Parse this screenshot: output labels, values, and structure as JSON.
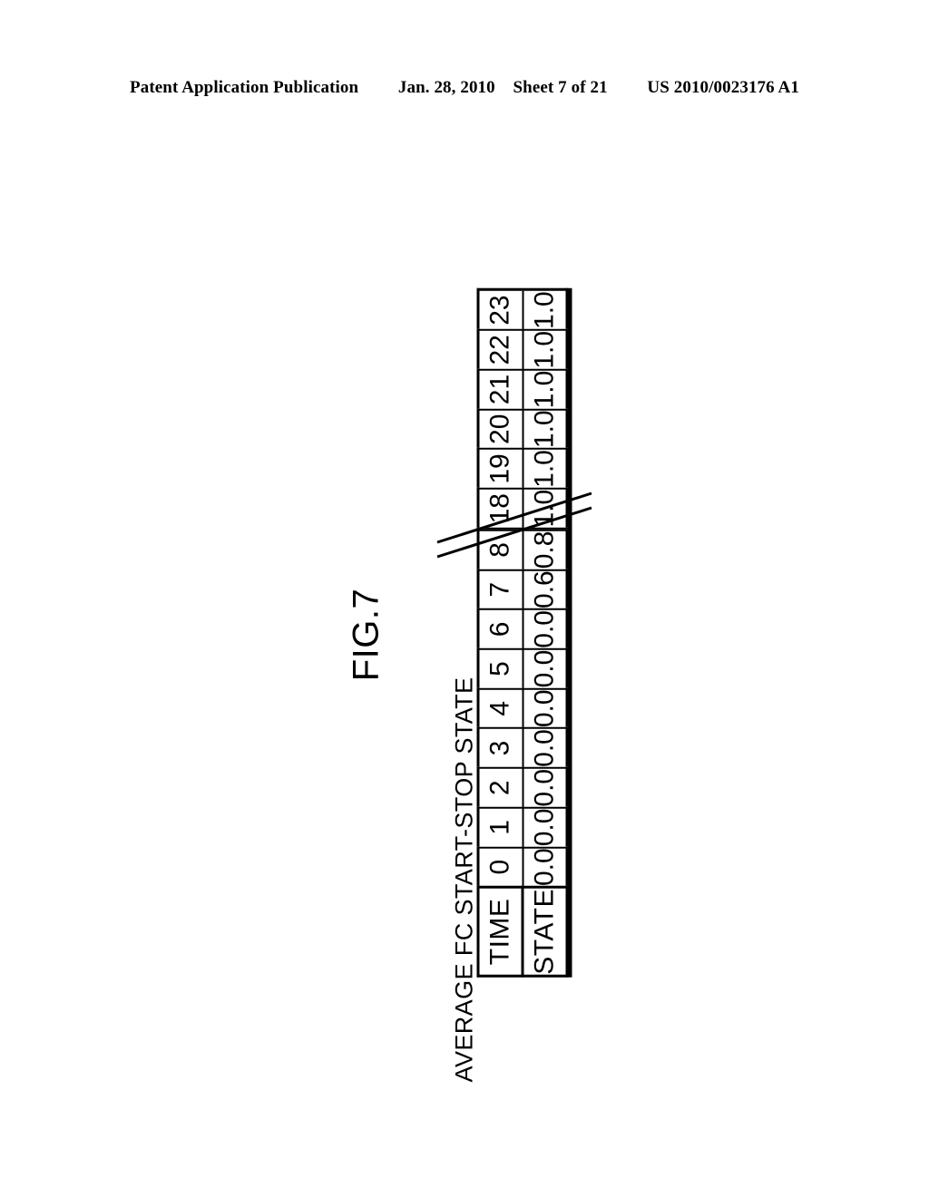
{
  "page": {
    "header": {
      "publication": "Patent Application Publication",
      "date": "Jan. 28, 2010",
      "sheet": "Sheet 7 of 21",
      "doc_number": "US 2010/0023176 A1"
    },
    "figure_label": "FIG.7",
    "caption": "AVERAGE FC START-STOP STATE"
  },
  "chart_data": {
    "type": "table",
    "title": "AVERAGE FC START-STOP STATE",
    "figure": "FIG.7",
    "orientation": "rotated-90-ccw",
    "row_headers": [
      "TIME",
      "STATE"
    ],
    "xlabel": "TIME",
    "ylabel": "STATE",
    "has_break": true,
    "break_after_index": 8,
    "break_symbol": "double-diagonal",
    "categories": [
      "0",
      "1",
      "2",
      "3",
      "4",
      "5",
      "6",
      "7",
      "8",
      "18",
      "19",
      "20",
      "21",
      "22",
      "23"
    ],
    "values": [
      0.0,
      0.0,
      0.0,
      0.0,
      0.0,
      0.0,
      0.0,
      0.6,
      0.8,
      1.0,
      1.0,
      1.0,
      1.0,
      1.0,
      1.0
    ],
    "columns": [
      {
        "time": "0",
        "state": "0.0"
      },
      {
        "time": "1",
        "state": "0.0"
      },
      {
        "time": "2",
        "state": "0.0"
      },
      {
        "time": "3",
        "state": "0.0"
      },
      {
        "time": "4",
        "state": "0.0"
      },
      {
        "time": "5",
        "state": "0.0"
      },
      {
        "time": "6",
        "state": "0.0"
      },
      {
        "time": "7",
        "state": "0.6"
      },
      {
        "time": "8",
        "state": "0.8"
      },
      {
        "time": "",
        "state": ""
      },
      {
        "time": "18",
        "state": "1.0"
      },
      {
        "time": "19",
        "state": "1.0"
      },
      {
        "time": "20",
        "state": "1.0"
      },
      {
        "time": "21",
        "state": "1.0"
      },
      {
        "time": "22",
        "state": "1.0"
      },
      {
        "time": "23",
        "state": "1.0"
      }
    ]
  },
  "colors": {
    "ink": "#000000",
    "paper": "#ffffff"
  }
}
